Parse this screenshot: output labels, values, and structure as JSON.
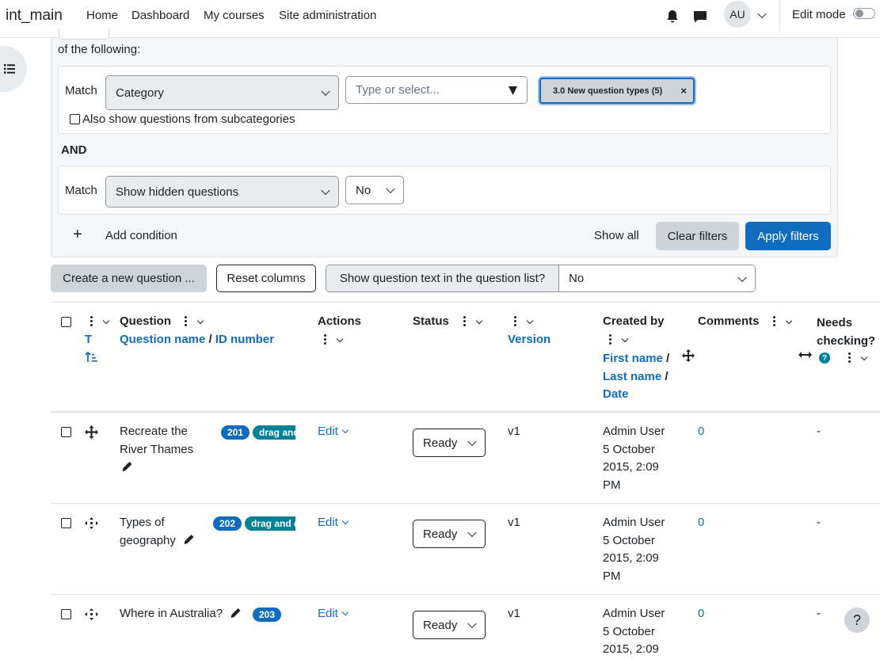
{
  "navbar": {
    "brand": "int_main",
    "links": [
      "Home",
      "Dashboard",
      "My courses",
      "Site administration"
    ],
    "avatar_initials": "AU",
    "edit_mode_label": "Edit mode"
  },
  "filters": {
    "intro": "of the following:",
    "condition1": {
      "match_label": "Match",
      "type_value": "Category",
      "search_placeholder": "Type or select...",
      "selected_tag": "3.0 New question types (5)",
      "tag_remove": "×",
      "subcategories_label": "Also show questions from subcategories"
    },
    "join_label": "AND",
    "condition2": {
      "match_label": "Match",
      "type_value": "Show hidden questions",
      "value": "No"
    },
    "add_condition_label": "Add condition",
    "add_condition_icon": "+",
    "show_all_label": "Show all",
    "clear_label": "Clear filters",
    "apply_label": "Apply filters"
  },
  "toolbar": {
    "create_label": "Create a new question ...",
    "reset_label": "Reset columns",
    "show_text_label": "Show question text in the question list?",
    "show_text_value": "No"
  },
  "table": {
    "headers": {
      "type_sort": "T",
      "question": "Question",
      "question_name": "Question name",
      "slash": "/",
      "id_number": "ID number",
      "actions": "Actions",
      "status": "Status",
      "version": "Version",
      "created_by": "Created by",
      "first_name": "First name",
      "last_name": "Last name",
      "date": "Date",
      "comments": "Comments",
      "needs_checking": "Needs checking?",
      "help_mark": "?"
    },
    "rows": [
      {
        "name_line1": "Recreate the",
        "name_line2": "River Thames",
        "id_badge": "201",
        "type_badge": "drag and drop",
        "action": "Edit",
        "status": "Ready",
        "version": "v1",
        "creator": "Admin User",
        "date_line1": "5 October",
        "date_line2": "2015, 2:09",
        "date_line3": "PM",
        "comments": "0",
        "needs_checking": "-"
      },
      {
        "name_line1": "Types of",
        "name_line2": "geography",
        "id_badge": "202",
        "type_badge": "drag and drop",
        "action": "Edit",
        "status": "Ready",
        "version": "v1",
        "creator": "Admin User",
        "date_line1": "5 October",
        "date_line2": "2015, 2:09",
        "date_line3": "PM",
        "comments": "0",
        "needs_checking": "-"
      },
      {
        "name_line1": "Where in Australia?",
        "id_badge": "203",
        "action": "Edit",
        "status": "Ready",
        "version": "v1",
        "creator": "Admin User",
        "date_line1": "5 October",
        "date_line2": "2015, 2:09",
        "comments": "0",
        "needs_checking": "-"
      }
    ]
  },
  "help_button": "?",
  "colors": {
    "link": "#0f6cbf",
    "primary": "#0f6cbf",
    "teal_badge": "#008196",
    "panel_bg": "#f5f6f7"
  }
}
